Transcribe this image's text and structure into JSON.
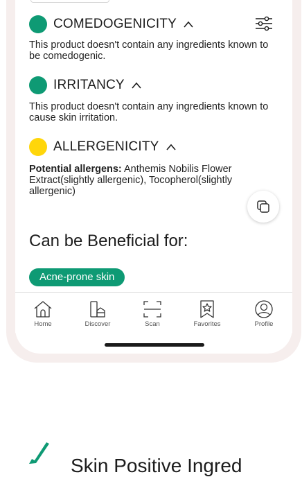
{
  "sections": [
    {
      "title": "COMEDOGENICITY",
      "color": "#0e9a74",
      "description": "This product doesn't contain any ingredients known to be comedogenic."
    },
    {
      "title": "IRRITANCY",
      "color": "#0e9a74",
      "description": "This product doesn't contain any ingredients known to cause skin irritation."
    },
    {
      "title": "ALLERGENICITY",
      "color": "#ffd60a",
      "allergens_label": "Potential allergens:",
      "allergens_text": " Anthemis Nobilis Flower Extract(slightly allergenic), Tocopherol(slightly allergenic)"
    }
  ],
  "beneficial": {
    "title": "Can be Beneficial for:",
    "chips": [
      "Acne-prone skin"
    ]
  },
  "tabbar": {
    "items": [
      {
        "label": "Home",
        "icon": "home-icon"
      },
      {
        "label": "Discover",
        "icon": "discover-icon"
      },
      {
        "label": "Scan",
        "icon": "scan-icon"
      },
      {
        "label": "Favorites",
        "icon": "favorites-icon"
      },
      {
        "label": "Profile",
        "icon": "profile-icon"
      }
    ]
  },
  "bottom_heading": "Skin Positive Ingred",
  "colors": {
    "accent": "#0e9a74",
    "warning": "#ffd60a",
    "frame": "#f6eeed"
  }
}
